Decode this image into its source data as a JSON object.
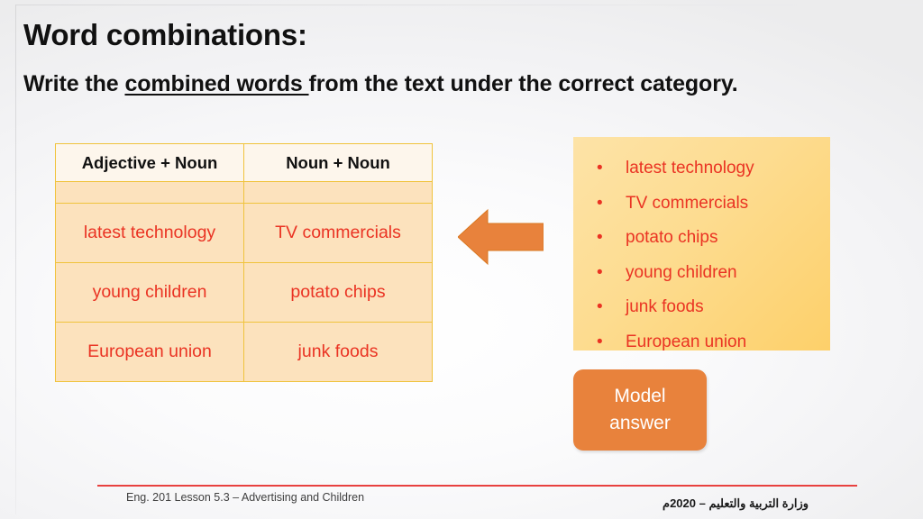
{
  "slide": {
    "title": "Word combinations:",
    "subtitle": {
      "before": "Write the ",
      "underlined": "combined words ",
      "after": "from the text under the correct category."
    }
  },
  "table": {
    "headers": [
      "Adjective + Noun",
      "Noun + Noun"
    ],
    "rows": [
      [
        "latest technology",
        "TV commercials"
      ],
      [
        "young children",
        "potato chips"
      ],
      [
        "European union",
        "junk foods"
      ]
    ]
  },
  "arrow": {
    "name": "left-arrow-icon",
    "color": "#e8823c",
    "direction": "left"
  },
  "source_list": {
    "bullet": "•",
    "items": [
      "latest technology",
      "TV commercials",
      "potato chips",
      "young children",
      "junk foods",
      "European union"
    ]
  },
  "model_button": {
    "line1": "Model",
    "line2": "answer",
    "color": "#e8823c"
  },
  "footer": {
    "left": "Eng. 201 Lesson 5.3 – Advertising and Children",
    "right": "وزارة التربية والتعليم – 2020م",
    "rule_color": "#e8413f"
  },
  "colors": {
    "text_red": "#ea3323",
    "table_border": "#f0c33c",
    "table_header_bg": "#fdf6ec",
    "table_cell_bg": "#fce2bd",
    "list_box_bg": "#fdd888",
    "accent_orange": "#e8823c"
  }
}
